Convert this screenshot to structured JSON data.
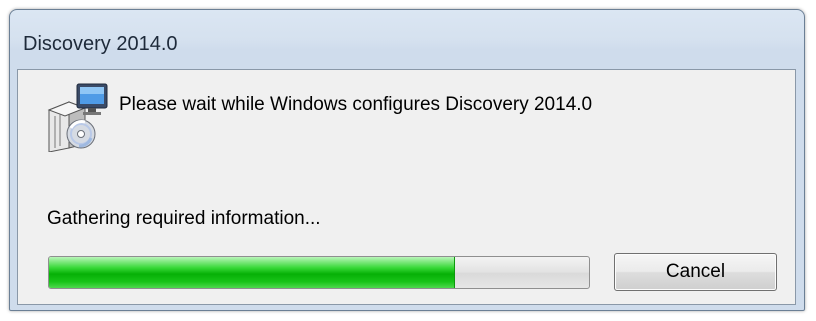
{
  "window": {
    "title": "Discovery 2014.0"
  },
  "dialog": {
    "icon": "installer-package-icon",
    "message": "Please wait while Windows configures Discovery 2014.0",
    "status": "Gathering required information...",
    "progress": 0.75,
    "cancel_label": "Cancel"
  },
  "colors": {
    "progress_fill": "#06b006",
    "title_bg": "#d5e1ef",
    "client_bg": "#f0f0f0"
  }
}
